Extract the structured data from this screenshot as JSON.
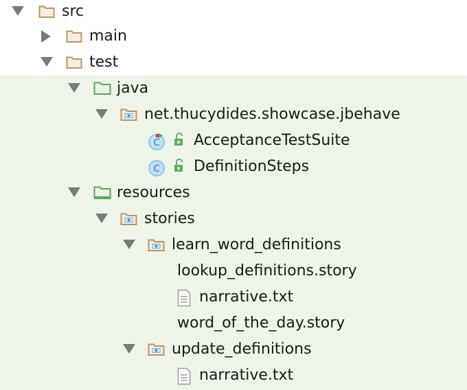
{
  "colors": {
    "folder_stroke": "#b89563",
    "folder_fill": "#f5ede0",
    "source_folder": "#5fa45f",
    "test_background": "#eef4e8",
    "class_icon": "#8fc7ee",
    "lock_icon": "#5faf5f"
  },
  "tree": [
    {
      "label": "src",
      "icon": "folder-icon",
      "expanded": true
    },
    {
      "label": "main",
      "icon": "folder-icon",
      "expanded": false
    },
    {
      "label": "test",
      "icon": "folder-icon",
      "expanded": true
    },
    {
      "label": "java",
      "icon": "source-folder-icon",
      "expanded": true
    },
    {
      "label": "net.thucydides.showcase.jbehave",
      "icon": "package-icon",
      "expanded": true
    },
    {
      "label": "AcceptanceTestSuite",
      "icon": "class-icon"
    },
    {
      "label": "DefinitionSteps",
      "icon": "class-icon"
    },
    {
      "label": "resources",
      "icon": "resource-folder-icon",
      "expanded": true
    },
    {
      "label": "stories",
      "icon": "package-icon",
      "expanded": true
    },
    {
      "label": "learn_word_definitions",
      "icon": "package-icon",
      "expanded": true
    },
    {
      "label": "lookup_definitions.story",
      "icon": ""
    },
    {
      "label": "narrative.txt",
      "icon": "text-file-icon"
    },
    {
      "label": "word_of_the_day.story",
      "icon": ""
    },
    {
      "label": "update_definitions",
      "icon": "package-icon",
      "expanded": true
    },
    {
      "label": "narrative.txt",
      "icon": "text-file-icon"
    }
  ]
}
